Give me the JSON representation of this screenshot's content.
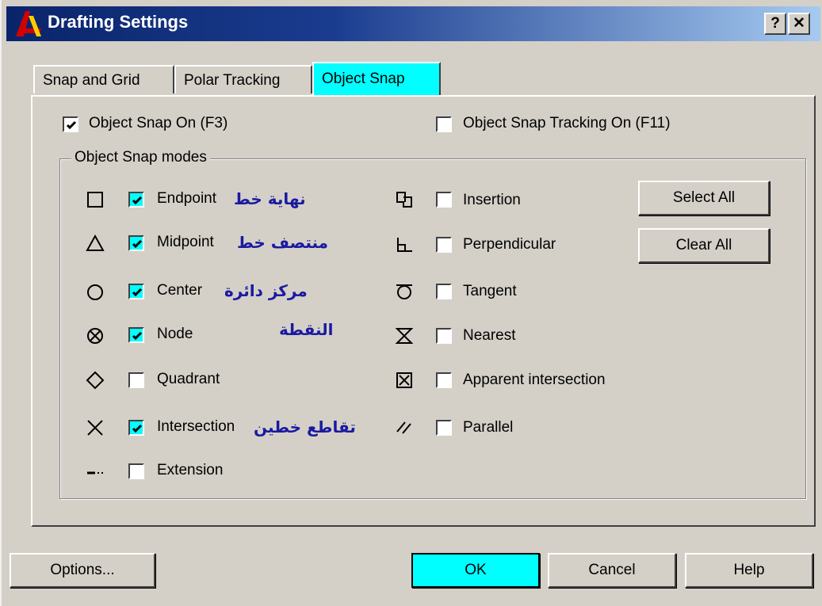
{
  "window": {
    "title": "Drafting Settings",
    "help_btn": "?",
    "close_btn": "✕"
  },
  "tabs": [
    {
      "label": "Snap and Grid",
      "active": false
    },
    {
      "label": "Polar Tracking",
      "active": false
    },
    {
      "label": "Object Snap",
      "active": true
    }
  ],
  "options": {
    "object_snap_on": {
      "label": "Object Snap On (F3)",
      "checked": true
    },
    "object_snap_tracking": {
      "label": "Object Snap Tracking On (F11)",
      "checked": false
    }
  },
  "group_title": "Object Snap modes",
  "left_modes": [
    {
      "icon": "square-icon",
      "label": "Endpoint",
      "arabic": "نهاية خط",
      "checked": true
    },
    {
      "icon": "triangle-icon",
      "label": "Midpoint",
      "arabic": "منتصف خط",
      "checked": true
    },
    {
      "icon": "circle-icon",
      "label": "Center",
      "arabic": "مركز دائرة",
      "checked": true
    },
    {
      "icon": "node-icon",
      "label": "Node",
      "arabic": "النقطة",
      "checked": true
    },
    {
      "icon": "diamond-icon",
      "label": "Quadrant",
      "arabic": "",
      "checked": false
    },
    {
      "icon": "x-icon",
      "label": "Intersection",
      "arabic": "تقاطع خطين",
      "checked": true
    },
    {
      "icon": "extension-icon",
      "label": "Extension",
      "arabic": "",
      "checked": false
    }
  ],
  "right_modes": [
    {
      "icon": "insertion-icon",
      "label": "Insertion",
      "checked": false
    },
    {
      "icon": "perpendicular-icon",
      "label": "Perpendicular",
      "checked": false
    },
    {
      "icon": "tangent-icon",
      "label": "Tangent",
      "checked": false
    },
    {
      "icon": "nearest-icon",
      "label": "Nearest",
      "checked": false
    },
    {
      "icon": "apparent-intersection-icon",
      "label": "Apparent intersection",
      "checked": false
    },
    {
      "icon": "parallel-icon",
      "label": "Parallel",
      "checked": false
    }
  ],
  "side_buttons": {
    "select_all": "Select All",
    "clear_all": "Clear All"
  },
  "footer": {
    "options": "Options...",
    "ok": "OK",
    "cancel": "Cancel",
    "help": "Help"
  }
}
